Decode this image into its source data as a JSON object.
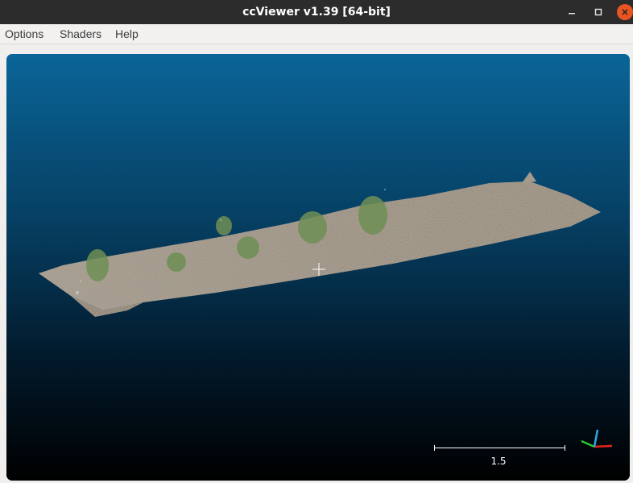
{
  "window": {
    "title": "ccViewer v1.39 [64-bit]",
    "controls": [
      "minimize-icon",
      "maximize-icon",
      "close-icon"
    ]
  },
  "menu": {
    "items": [
      {
        "label": "Options"
      },
      {
        "label": "Shaders"
      },
      {
        "label": "Help"
      }
    ]
  },
  "viewport": {
    "background_top": "#0a6598",
    "background_bottom": "#000000",
    "scale_bar_label": "1.5",
    "axis_colors": {
      "x": "#e8241a",
      "y": "#2ec52e",
      "z": "#2ea8e6"
    }
  }
}
